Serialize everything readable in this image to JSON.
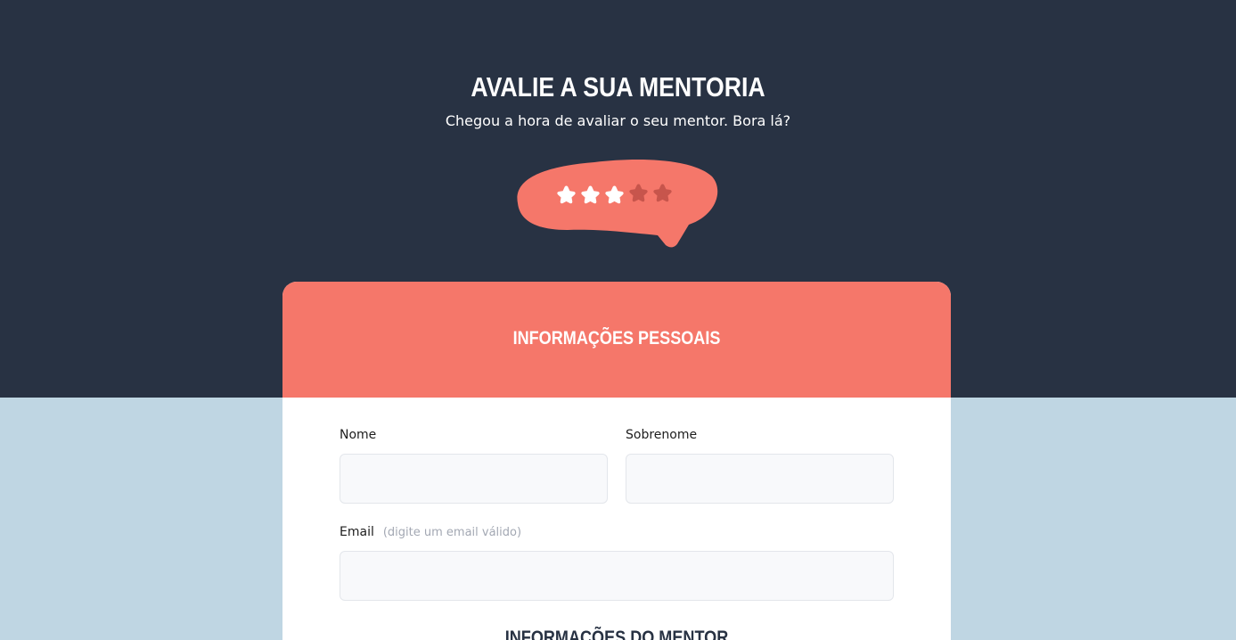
{
  "header": {
    "title": "AVALIE A SUA MENTORIA",
    "subtitle": "Chegou a hora de avaliar o seu mentor. Bora lá?"
  },
  "rating": {
    "value": 3,
    "max": 5,
    "icon": "star-icon",
    "active_color": "#ffffff",
    "inactive_color": "#c7554c",
    "bubble_color": "#f5776a"
  },
  "personal_info": {
    "title": "INFORMAÇÕES PESSOAIS",
    "fields": {
      "first_name": {
        "label": "Nome",
        "value": "",
        "placeholder": ""
      },
      "last_name": {
        "label": "Sobrenome",
        "value": "",
        "placeholder": ""
      },
      "email": {
        "label": "Email",
        "hint": "(digite um email válido)",
        "value": "",
        "placeholder": ""
      }
    }
  },
  "mentor_info": {
    "title": "INFORMAÇÕES DO MENTOR"
  },
  "colors": {
    "dark_background": "#283243",
    "light_background": "#bfd6e3",
    "accent": "#f5776a",
    "card": "#ffffff"
  }
}
